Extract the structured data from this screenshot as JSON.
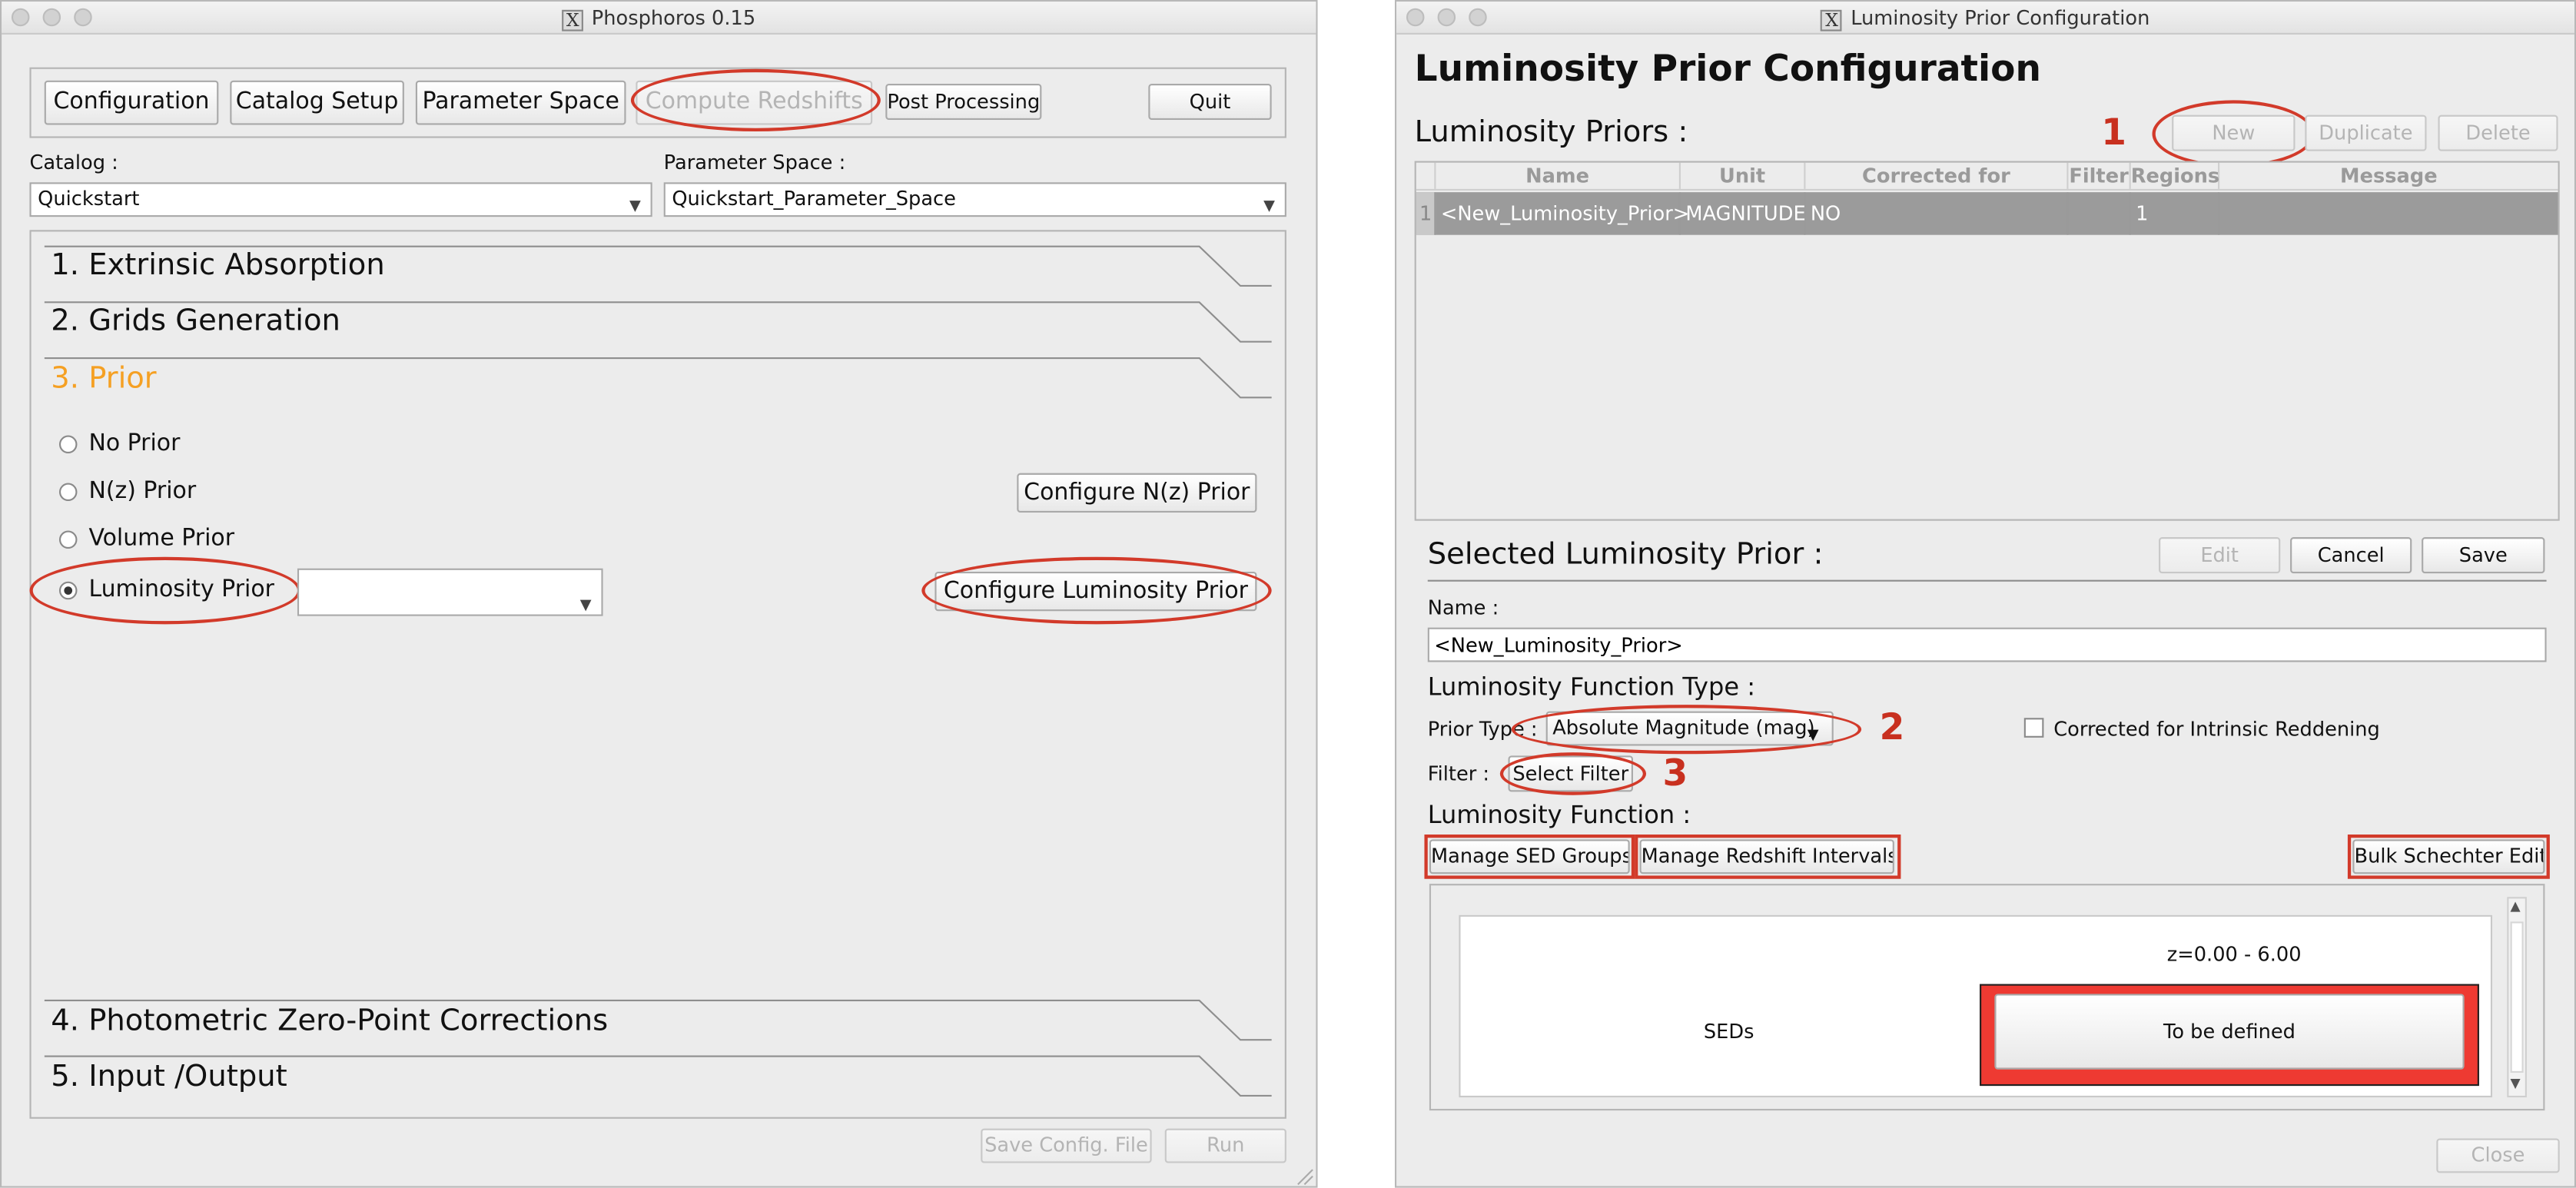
{
  "left_window": {
    "title": "Phosphoros 0.15",
    "toolbar": {
      "configuration": "Configuration",
      "catalog_setup": "Catalog Setup",
      "parameter_space": "Parameter Space",
      "compute_redshifts": "Compute Redshifts",
      "post_processing": "Post Processing",
      "quit": "Quit"
    },
    "catalog_label": "Catalog :",
    "catalog_value": "Quickstart",
    "parameter_space_label": "Parameter Space :",
    "parameter_space_value": "Quickstart_Parameter_Space",
    "sections": {
      "s1": "1. Extrinsic Absorption",
      "s2": "2. Grids Generation",
      "s3": "3. Prior",
      "s4": "4. Photometric Zero-Point Corrections",
      "s5": "5. Input /Output"
    },
    "prior": {
      "no_prior": "No Prior",
      "nz_prior": "N(z) Prior",
      "volume_prior": "Volume Prior",
      "luminosity_prior": "Luminosity Prior",
      "luminosity_prior_select": "",
      "selected": "luminosity_prior",
      "configure_nz": "Configure N(z) Prior",
      "configure_luminosity": "Configure Luminosity Prior"
    },
    "footer": {
      "save_config": "Save Config. File",
      "run": "Run"
    }
  },
  "right_window": {
    "title": "Luminosity Prior Configuration",
    "heading": "Luminosity Prior Configuration",
    "priors_label": "Luminosity Priors :",
    "buttons": {
      "new": "New",
      "duplicate": "Duplicate",
      "delete": "Delete"
    },
    "table": {
      "columns": [
        "Name",
        "Unit",
        "Corrected for Reddening",
        "Filter",
        "Regions",
        "Message"
      ],
      "rows": [
        {
          "index": "1",
          "name": "<New_Luminosity_Prior>",
          "unit": "MAGNITUDE",
          "corrected": "NO",
          "filter": "",
          "regions": "1",
          "message": ""
        }
      ]
    },
    "selected_label": "Selected Luminosity Prior :",
    "edit_buttons": {
      "edit": "Edit",
      "cancel": "Cancel",
      "save": "Save"
    },
    "name_label": "Name :",
    "name_value": "<New_Luminosity_Prior>",
    "function_type_label": "Luminosity Function Type :",
    "prior_type_label": "Prior Type :",
    "prior_type_value": "Absolute Magnitude (mag)",
    "corrected_checkbox": "Corrected for Intrinsic Reddening",
    "filter_label": "Filter :",
    "select_filter": "Select Filter",
    "function_label": "Luminosity Function :",
    "manage_sed_groups": "Manage SED Groups",
    "manage_redshift_intervals": "Manage Redshift Intervals",
    "bulk_schechter_edit": "Bulk Schechter Edit",
    "grid": {
      "z_header": "z=0.00 - 6.00",
      "row_label": "SEDs",
      "cell": "To be defined"
    },
    "close": "Close"
  },
  "annotations": {
    "n1": "1",
    "n2": "2",
    "n3": "3"
  },
  "colors": {
    "annotation_red": "#d23a2a",
    "prior_heading": "#f5a023",
    "selected_row": "#9b9b9b",
    "undefined_cell": "#ee3a32"
  }
}
